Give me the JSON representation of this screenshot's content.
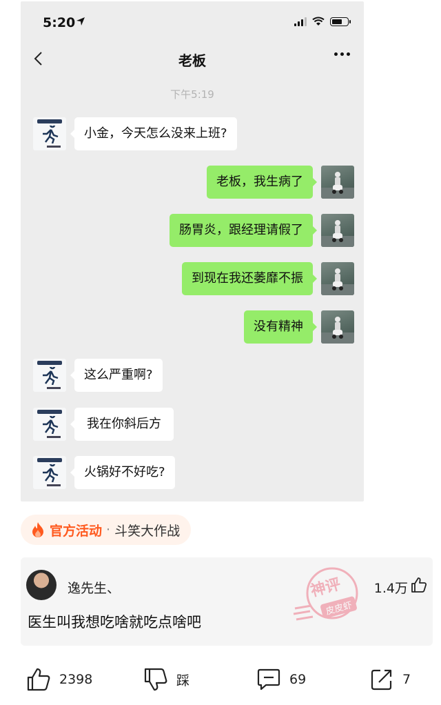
{
  "status_bar": {
    "time": "5:20"
  },
  "chat": {
    "title": "老板",
    "timestamp": "下午5:19",
    "messages": [
      {
        "from": "boss",
        "text": "小金，今天怎么没来上班?"
      },
      {
        "from": "me",
        "text": "老板，我生病了"
      },
      {
        "from": "me",
        "text": "肠胃炎，跟经理请假了"
      },
      {
        "from": "me",
        "text": "到现在我还萎靡不振"
      },
      {
        "from": "me",
        "text": "没有精神"
      },
      {
        "from": "boss",
        "text": "这么严重啊?"
      },
      {
        "from": "boss",
        "text": "我在你斜后方"
      },
      {
        "from": "boss",
        "text": "火锅好不好吃?"
      }
    ]
  },
  "activity": {
    "icon": "fire-icon",
    "label": "官方活动",
    "separator": "·",
    "name": "斗笑大作战"
  },
  "comment": {
    "username": "逸先生、",
    "likes": "1.4万",
    "text": "医生叫我想吃啥就吃点啥吧",
    "stamp_top": "神评",
    "stamp_bottom": "皮皮虾"
  },
  "actions": {
    "like_count": "2398",
    "dislike_label": "踩",
    "comment_count": "69",
    "share_count": "7"
  },
  "colors": {
    "chat_bg": "#ededed",
    "sent_bubble": "#95ec69",
    "received_bubble": "#ffffff",
    "activity_accent": "#ff5a1f"
  }
}
